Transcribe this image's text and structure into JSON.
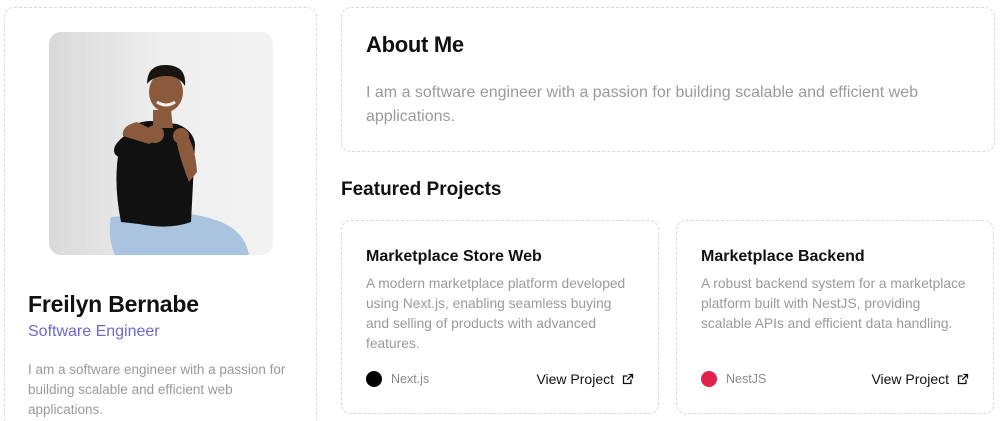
{
  "profile": {
    "name": "Freilyn Bernabe",
    "role": "Software Engineer",
    "bio": "I am a software engineer with a passion for building scalable and efficient web applications.",
    "accent_color": "#6d68c9"
  },
  "about": {
    "title": "About Me",
    "text": "I am a software engineer with a passion for building scalable and efficient web applications."
  },
  "featured": {
    "title": "Featured Projects",
    "projects": [
      {
        "title": "Marketplace Store Web",
        "description": "A modern marketplace platform developed using Next.js, enabling seamless buying and selling of products with advanced features.",
        "tech": "Next.js",
        "tech_color": "#000000",
        "link_label": "View Project",
        "link_icon": "external-link-icon"
      },
      {
        "title": "Marketplace Backend",
        "description": "A robust backend system for a marketplace platform built with NestJS, providing scalable APIs and efficient data handling.",
        "tech": "NestJS",
        "tech_color": "#e0234e",
        "link_label": "View Project",
        "link_icon": "external-link-icon"
      }
    ]
  }
}
